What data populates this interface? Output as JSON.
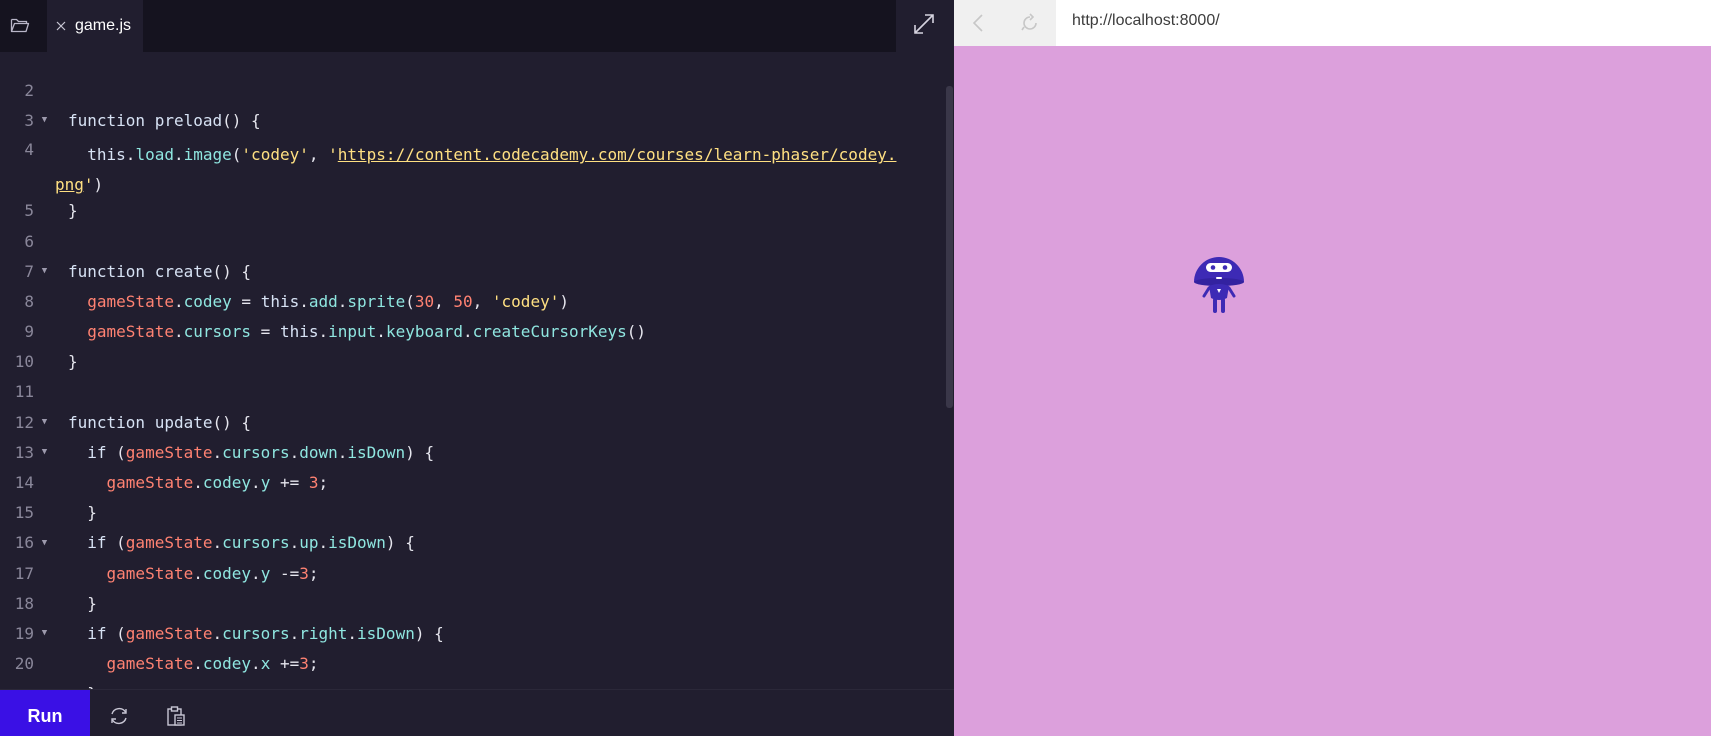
{
  "editor": {
    "tab": {
      "filename": "game.js",
      "close_icon": "close-icon"
    },
    "icons": {
      "folder": "folder-icon",
      "expand": "expand-icon"
    },
    "lines": [
      {
        "n": "2",
        "fold": false,
        "tokens": []
      },
      {
        "n": "3",
        "fold": true,
        "tokens": [
          [
            "kw",
            "function "
          ],
          [
            "fn",
            "preload"
          ],
          [
            "pl",
            "() {"
          ]
        ]
      },
      {
        "n": "4",
        "fold": false,
        "wrap": true,
        "tokens": [
          [
            "pl",
            "  "
          ],
          [
            "kw",
            "this"
          ],
          [
            "pl",
            "."
          ],
          [
            "pr",
            "load"
          ],
          [
            "pl",
            "."
          ],
          [
            "pr",
            "image"
          ],
          [
            "pl",
            "("
          ],
          [
            "st",
            "'codey'"
          ],
          [
            "pl",
            ", "
          ],
          [
            "st",
            "'"
          ],
          [
            "ln",
            "https://content.codecademy.com/courses/learn-phaser/codey."
          ]
        ],
        "tokens2": [
          [
            "ln",
            "png"
          ],
          [
            "st",
            "'"
          ],
          [
            "pl",
            ")"
          ]
        ]
      },
      {
        "n": "5",
        "fold": false,
        "tokens": [
          [
            "pl",
            "}"
          ]
        ]
      },
      {
        "n": "6",
        "fold": false,
        "tokens": []
      },
      {
        "n": "7",
        "fold": true,
        "tokens": [
          [
            "kw",
            "function "
          ],
          [
            "fn",
            "create"
          ],
          [
            "pl",
            "() {"
          ]
        ]
      },
      {
        "n": "8",
        "fold": false,
        "tokens": [
          [
            "pl",
            "  "
          ],
          [
            "vr",
            "gameState"
          ],
          [
            "pl",
            "."
          ],
          [
            "pr",
            "codey"
          ],
          [
            "pl",
            " = "
          ],
          [
            "kw",
            "this"
          ],
          [
            "pl",
            "."
          ],
          [
            "pr",
            "add"
          ],
          [
            "pl",
            "."
          ],
          [
            "pr",
            "sprite"
          ],
          [
            "pl",
            "("
          ],
          [
            "nm",
            "30"
          ],
          [
            "pl",
            ", "
          ],
          [
            "nm",
            "50"
          ],
          [
            "pl",
            ", "
          ],
          [
            "st",
            "'codey'"
          ],
          [
            "pl",
            ")"
          ]
        ]
      },
      {
        "n": "9",
        "fold": false,
        "tokens": [
          [
            "pl",
            "  "
          ],
          [
            "vr",
            "gameState"
          ],
          [
            "pl",
            "."
          ],
          [
            "pr",
            "cursors"
          ],
          [
            "pl",
            " = "
          ],
          [
            "kw",
            "this"
          ],
          [
            "pl",
            "."
          ],
          [
            "pr",
            "input"
          ],
          [
            "pl",
            "."
          ],
          [
            "pr",
            "keyboard"
          ],
          [
            "pl",
            "."
          ],
          [
            "pr",
            "createCursorKeys"
          ],
          [
            "pl",
            "()"
          ]
        ]
      },
      {
        "n": "10",
        "fold": false,
        "tokens": [
          [
            "pl",
            "}"
          ]
        ]
      },
      {
        "n": "11",
        "fold": false,
        "tokens": []
      },
      {
        "n": "12",
        "fold": true,
        "tokens": [
          [
            "kw",
            "function "
          ],
          [
            "fn",
            "update"
          ],
          [
            "pl",
            "() {"
          ]
        ]
      },
      {
        "n": "13",
        "fold": true,
        "tokens": [
          [
            "pl",
            "  "
          ],
          [
            "kw",
            "if"
          ],
          [
            "pl",
            " ("
          ],
          [
            "vr",
            "gameState"
          ],
          [
            "pl",
            "."
          ],
          [
            "pr",
            "cursors"
          ],
          [
            "pl",
            "."
          ],
          [
            "pr",
            "down"
          ],
          [
            "pl",
            "."
          ],
          [
            "pr",
            "isDown"
          ],
          [
            "pl",
            ") {"
          ]
        ]
      },
      {
        "n": "14",
        "fold": false,
        "tokens": [
          [
            "pl",
            "    "
          ],
          [
            "vr",
            "gameState"
          ],
          [
            "pl",
            "."
          ],
          [
            "pr",
            "codey"
          ],
          [
            "pl",
            "."
          ],
          [
            "pr",
            "y"
          ],
          [
            "pl",
            " += "
          ],
          [
            "nm",
            "3"
          ],
          [
            "pl",
            ";"
          ]
        ]
      },
      {
        "n": "15",
        "fold": false,
        "tokens": [
          [
            "pl",
            "  }"
          ]
        ]
      },
      {
        "n": "16",
        "fold": true,
        "tokens": [
          [
            "pl",
            "  "
          ],
          [
            "kw",
            "if"
          ],
          [
            "pl",
            " ("
          ],
          [
            "vr",
            "gameState"
          ],
          [
            "pl",
            "."
          ],
          [
            "pr",
            "cursors"
          ],
          [
            "pl",
            "."
          ],
          [
            "pr",
            "up"
          ],
          [
            "pl",
            "."
          ],
          [
            "pr",
            "isDown"
          ],
          [
            "pl",
            ") {"
          ]
        ]
      },
      {
        "n": "17",
        "fold": false,
        "tokens": [
          [
            "pl",
            "    "
          ],
          [
            "vr",
            "gameState"
          ],
          [
            "pl",
            "."
          ],
          [
            "pr",
            "codey"
          ],
          [
            "pl",
            "."
          ],
          [
            "pr",
            "y"
          ],
          [
            "pl",
            " -="
          ],
          [
            "nm",
            "3"
          ],
          [
            "pl",
            ";"
          ]
        ]
      },
      {
        "n": "18",
        "fold": false,
        "tokens": [
          [
            "pl",
            "  }"
          ]
        ]
      },
      {
        "n": "19",
        "fold": true,
        "tokens": [
          [
            "pl",
            "  "
          ],
          [
            "kw",
            "if"
          ],
          [
            "pl",
            " ("
          ],
          [
            "vr",
            "gameState"
          ],
          [
            "pl",
            "."
          ],
          [
            "pr",
            "cursors"
          ],
          [
            "pl",
            "."
          ],
          [
            "pr",
            "right"
          ],
          [
            "pl",
            "."
          ],
          [
            "pr",
            "isDown"
          ],
          [
            "pl",
            ") {"
          ]
        ]
      },
      {
        "n": "20",
        "fold": false,
        "tokens": [
          [
            "pl",
            "    "
          ],
          [
            "vr",
            "gameState"
          ],
          [
            "pl",
            "."
          ],
          [
            "pr",
            "codey"
          ],
          [
            "pl",
            "."
          ],
          [
            "pr",
            "x"
          ],
          [
            "pl",
            " +="
          ],
          [
            "nm",
            "3"
          ],
          [
            "pl",
            ";"
          ]
        ]
      },
      {
        "n": "",
        "fold": false,
        "tokens": [
          [
            "pl",
            "  }"
          ]
        ]
      }
    ]
  },
  "toolbar": {
    "run_label": "Run",
    "refresh_icon": "refresh-icon",
    "clipboard_icon": "clipboard-icon"
  },
  "browser": {
    "url": "http://localhost:8000/",
    "back_icon": "back-icon",
    "reload_icon": "reload-icon",
    "game_background": "#dca0dc",
    "sprite_name": "codey"
  },
  "colors": {
    "editor_bg": "#211e2f",
    "run_button": "#3a10e5",
    "game_bg": "#dca0dc"
  }
}
